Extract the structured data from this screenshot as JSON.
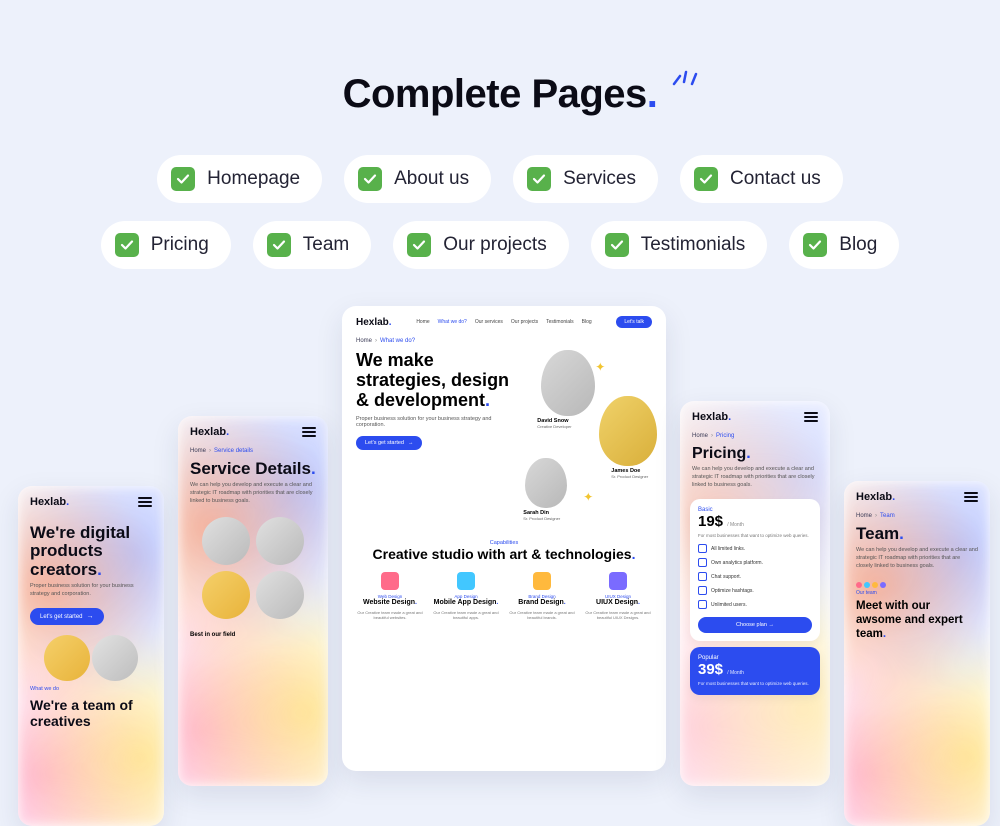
{
  "heading": "Complete Pages",
  "chips": [
    "Homepage",
    "About us",
    "Services",
    "Contact us",
    "Pricing",
    "Team",
    "Our projects",
    "Testimonials",
    "Blog"
  ],
  "brand": "Hexlab",
  "preview1": {
    "title_a": "We're digital products creators",
    "sub": "Proper business solution for your business strategy and corporation.",
    "cta": "Let's get started",
    "what": "What we do",
    "title_b": "We're a team of creatives"
  },
  "preview2": {
    "crumb_home": "Home",
    "crumb_page": "Service details",
    "title": "Service Details",
    "sub": "We can help you develop and execute a clear and strategic IT roadmap with priorities that are closely linked to business goals.",
    "best": "Best in our field"
  },
  "preview3": {
    "nav": [
      "Home",
      "What we do?",
      "Our services",
      "Our projects",
      "Testimonials",
      "Blog"
    ],
    "cta_nav": "Let's talk",
    "crumb_home": "Home",
    "crumb_page": "What we do?",
    "title": "We make strategies, design & development",
    "sub": "Proper business solution for your business strategy and corporation.",
    "cta": "Let's get started",
    "people": [
      {
        "name": "David Snow",
        "role": "Creative Developer"
      },
      {
        "name": "James Doe",
        "role": "Sr. Product Designer"
      },
      {
        "name": "Sarah Din",
        "role": "Sr. Product Designer"
      }
    ],
    "cap_label": "Capabilities",
    "cap_title": "Creative studio with art & technologies",
    "services": [
      {
        "label": "Web Design",
        "name": "Website Design",
        "desc": "Our Creative team made a great and beautiful websites."
      },
      {
        "label": "App Design",
        "name": "Mobile App Design",
        "desc": "Our Creative team made a great and beautiful apps."
      },
      {
        "label": "Brand Design",
        "name": "Brand Design",
        "desc": "Our Creative team made a great and beautiful brands."
      },
      {
        "label": "UIUX Design",
        "name": "UIUX Design",
        "desc": "Our Creative team made a great and beautiful UIUX Designs."
      }
    ]
  },
  "preview4": {
    "crumb_home": "Home",
    "crumb_page": "Pricing",
    "title": "Pricing",
    "sub": "We can help you develop and execute a clear and strategic IT roadmap with priorities that are closely linked to business goals.",
    "plan_basic": {
      "name": "Basic",
      "price": "19$",
      "per": "/ Month",
      "desc": "For most businesses that want to optimize web queries.",
      "features": [
        "All limited links.",
        "Own analytics platform.",
        "Chat support.",
        "Optimize hashtags.",
        "Unlimited users."
      ],
      "cta": "Choose plan"
    },
    "plan_popular": {
      "name": "Popular",
      "price": "39$",
      "per": "/ Month",
      "desc": "For most businesses that want to optimize web queries."
    }
  },
  "preview5": {
    "crumb_home": "Home",
    "crumb_page": "Team",
    "title": "Team",
    "sub": "We can help you develop and execute a clear and strategic IT roadmap with priorities that are closely linked to business goals.",
    "our": "Our team",
    "headline": "Meet with our awsome and expert team"
  }
}
